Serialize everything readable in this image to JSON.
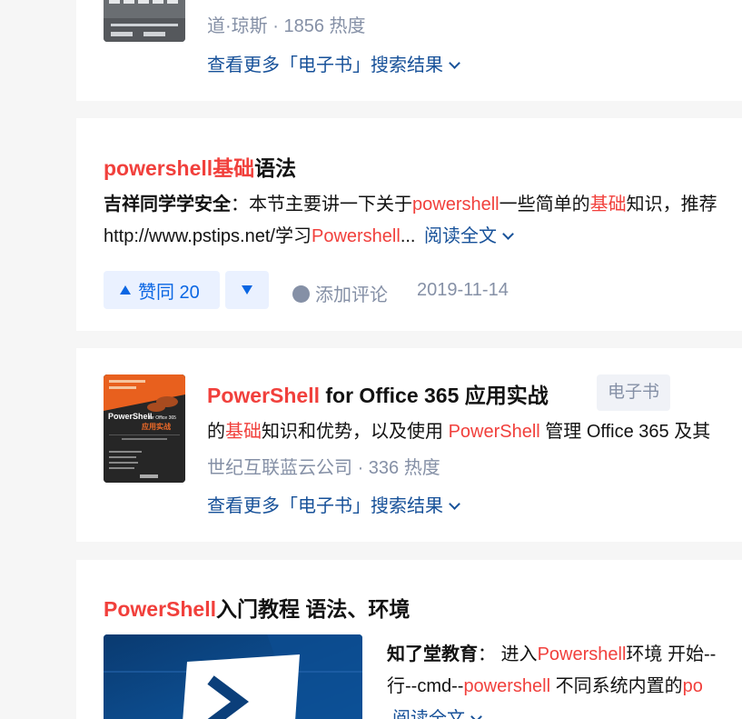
{
  "card1": {
    "meta_author": "道·琼斯",
    "meta_sep": "·",
    "meta_heat": "1856 热度",
    "more_link": "查看更多「电子书」搜索结果"
  },
  "card2": {
    "title_hl": "powershell基础",
    "title_rest": "语法",
    "author": "吉祥同学学安全",
    "line1_a": "：本节主要讲一下关于",
    "line1_hl1": "powershell",
    "line1_b": "一些简单的",
    "line1_hl2": "基础",
    "line1_c": "知识，推荐",
    "line2_a": "http://www.pstips.net/学习",
    "line2_hl": "Powershell",
    "line2_b": "...",
    "read_more": "阅读全文",
    "vote_label": "赞同 20",
    "comment_label": "添加评论",
    "date": "2019-11-14"
  },
  "card3": {
    "title_hl": "PowerShell",
    "title_rest": " for Office 365 应用实战",
    "badge": "电子书",
    "line1_a": "的",
    "line1_hl1": "基础",
    "line1_b": "知识和优势，以及使用 ",
    "line1_hl2": "PowerShell",
    "line1_c": " 管理 Office 365 及其",
    "meta_publisher": "世纪互联蓝云公司",
    "meta_sep": "·",
    "meta_heat": "336 热度",
    "more_link": "查看更多「电子书」搜索结果",
    "cover_title": "PowerShell for Office 365",
    "cover_subtitle": "应用实战"
  },
  "card4": {
    "title_hl": "PowerShell",
    "title_rest": "入门教程 语法、环境",
    "author": "知了堂教育",
    "line1_a": "：  进入",
    "line1_hl": "Powershell",
    "line1_b": "环境 开始--",
    "line2_a": "行--cmd--",
    "line2_hl1": "powershell",
    "line2_b": " 不同系统内置的",
    "line2_hl2": "po",
    "read_more": "阅读全文"
  },
  "colors": {
    "highlight": "#f1403c",
    "link": "#175199",
    "muted": "#8590a6",
    "vote_bg": "#eaf1ff",
    "vote_fg": "#0a66e3"
  }
}
